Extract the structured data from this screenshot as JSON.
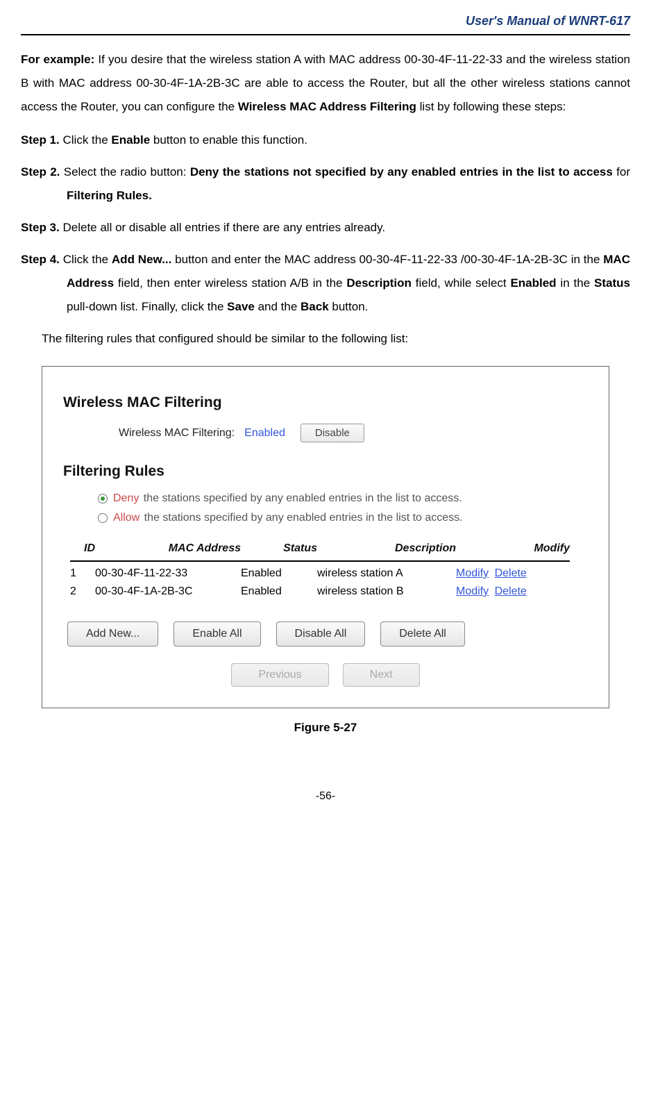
{
  "header": {
    "title": "User's Manual of WNRT-617"
  },
  "intro": {
    "for_example_label": "For example:",
    "text_part1": " If you desire that the wireless station A with MAC address 00-30-4F-11-22-33 and the wireless station B with MAC address 00-30-4F-1A-2B-3C are able to access the Router, but all the other wireless stations cannot access the Router, you can configure the ",
    "bold1": "Wireless MAC Address Filtering",
    "text_part2": " list by following these steps:"
  },
  "steps": {
    "s1": {
      "label": "Step 1.",
      "t1": "Click the ",
      "b1": "Enable",
      "t2": " button to enable this function."
    },
    "s2": {
      "label": "Step 2.",
      "t1": "Select the radio button: ",
      "b1": "Deny the stations not specified by any enabled entries in the list to access",
      "t2": " for ",
      "b2": "Filtering Rules."
    },
    "s3": {
      "label": "Step 3.",
      "t1": "Delete all or disable all entries if there are any entries already."
    },
    "s4": {
      "label": "Step 4.",
      "t1": "Click the ",
      "b1": "Add New...",
      "t2": " button and enter the MAC address 00-30-4F-11-22-33 /00-30-4F-1A-2B-3C in the ",
      "b2": "MAC Address",
      "t3": " field, then enter wireless station A/B in the ",
      "b3": "Description",
      "t4": " field, while select ",
      "b4": "Enabled",
      "t5": " in the ",
      "b5": "Status",
      "t6": " pull-down list. Finally, click the ",
      "b6": "Save",
      "t7": " and the ",
      "b7": "Back",
      "t8": " button."
    }
  },
  "note": "The filtering rules that configured should be similar to the following list:",
  "figure": {
    "section1_title": "Wireless MAC Filtering",
    "status_label": "Wireless MAC Filtering:",
    "status_value": "Enabled",
    "disable_button": "Disable",
    "section2_title": "Filtering Rules",
    "rule_deny_keyword": "Deny",
    "rule_deny_text": " the stations specified by any enabled entries in the list to access.",
    "rule_allow_keyword": "Allow",
    "rule_allow_text": " the stations specified by any enabled entries in the list to access.",
    "table": {
      "headers": {
        "id": "ID",
        "mac": "MAC Address",
        "status": "Status",
        "desc": "Description",
        "modify": "Modify"
      },
      "rows": [
        {
          "id": "1",
          "mac": "00-30-4F-11-22-33",
          "status": "Enabled",
          "desc": "wireless station A",
          "modify": "Modify",
          "delete": "Delete"
        },
        {
          "id": "2",
          "mac": "00-30-4F-1A-2B-3C",
          "status": "Enabled",
          "desc": "wireless station B",
          "modify": "Modify",
          "delete": "Delete"
        }
      ]
    },
    "buttons": {
      "add_new": "Add New...",
      "enable_all": "Enable All",
      "disable_all": "Disable All",
      "delete_all": "Delete All"
    },
    "pager": {
      "prev": "Previous",
      "next": "Next"
    }
  },
  "figure_caption": "Figure 5-27",
  "page_number": "-56-"
}
